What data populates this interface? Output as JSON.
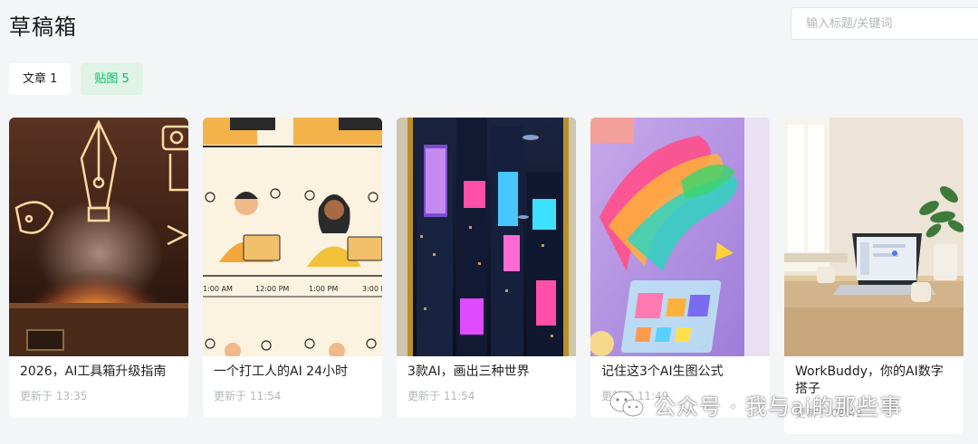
{
  "page": {
    "title": "草稿箱"
  },
  "search": {
    "placeholder": "输入标题/关键词"
  },
  "tabs": [
    {
      "label": "文章 1",
      "active": false
    },
    {
      "label": "贴图 5",
      "active": true
    }
  ],
  "cards": [
    {
      "title": "2026，AI工具箱升级指南",
      "time": "更新于 13:35"
    },
    {
      "title": "一个打工人的AI 24小时",
      "time": "更新于 11:54"
    },
    {
      "title": "3款AI，画出三种世界",
      "time": "更新于 11:54"
    },
    {
      "title": "记住这3个AI生图公式",
      "time": "更新于 11:49"
    },
    {
      "title": "WorkBuddy，你的AI数字搭子",
      "time": "更新于 09:49"
    }
  ],
  "comic_clock": {
    "times": [
      "1:00 AM",
      "12:00 PM",
      "1:00 PM",
      "3:00 P"
    ]
  },
  "watermark": {
    "text": "公众号 · 我与ai的那些事"
  },
  "colors": {
    "accent": "#07c160",
    "active_tab_bg": "#dff3e7",
    "page_bg": "#f4f5f7"
  }
}
